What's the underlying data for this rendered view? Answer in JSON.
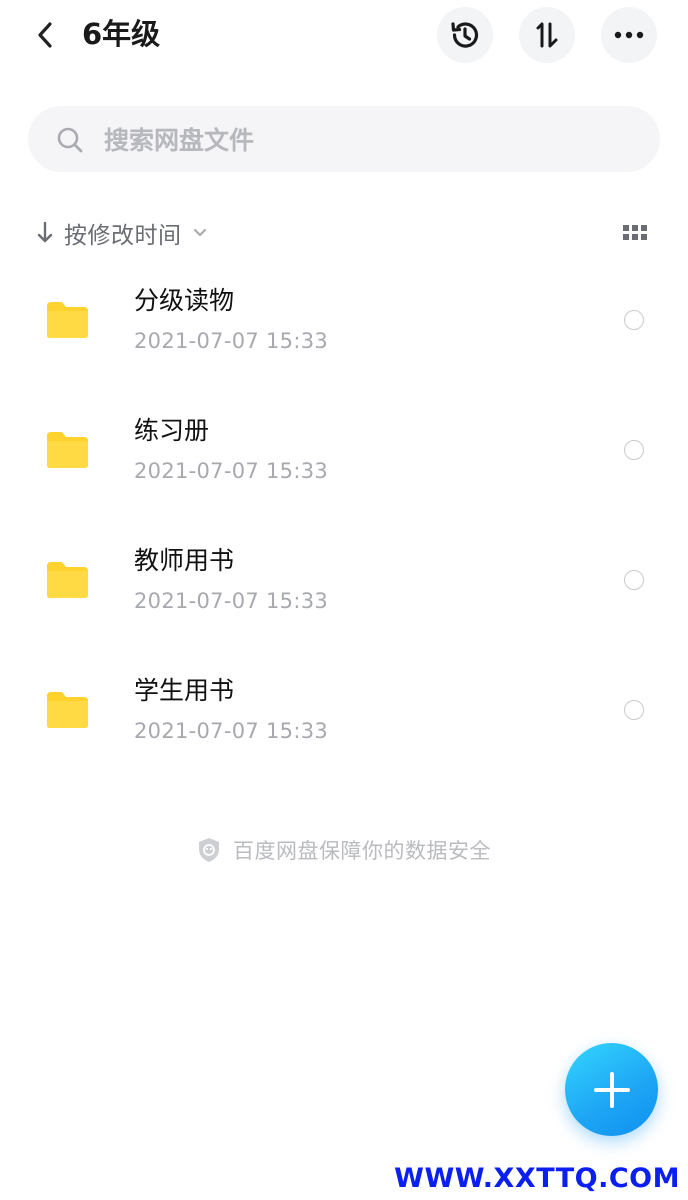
{
  "header": {
    "title": "6年级",
    "back_icon": "chevron-left-icon",
    "actions": [
      "history-icon",
      "sort-order-icon",
      "more-dots-icon"
    ]
  },
  "search": {
    "placeholder": "搜索网盘文件",
    "value": ""
  },
  "sortbar": {
    "label": "按修改时间",
    "view_icon": "grid-view-icon"
  },
  "files": [
    {
      "name": "分级读物",
      "date": "2021-07-07  15:33",
      "type": "folder"
    },
    {
      "name": "练习册",
      "date": "2021-07-07  15:33",
      "type": "folder"
    },
    {
      "name": "教师用书",
      "date": "2021-07-07  15:33",
      "type": "folder"
    },
    {
      "name": "学生用书",
      "date": "2021-07-07  15:33",
      "type": "folder"
    }
  ],
  "footer": {
    "text": "百度网盘保障你的数据安全"
  },
  "watermark": "WWW.XXTTQ.COM",
  "colors": {
    "folder": "#FFD22E",
    "fab_start": "#34D6FF",
    "fab_end": "#0E8FF0",
    "watermark": "#0A1FF0"
  }
}
